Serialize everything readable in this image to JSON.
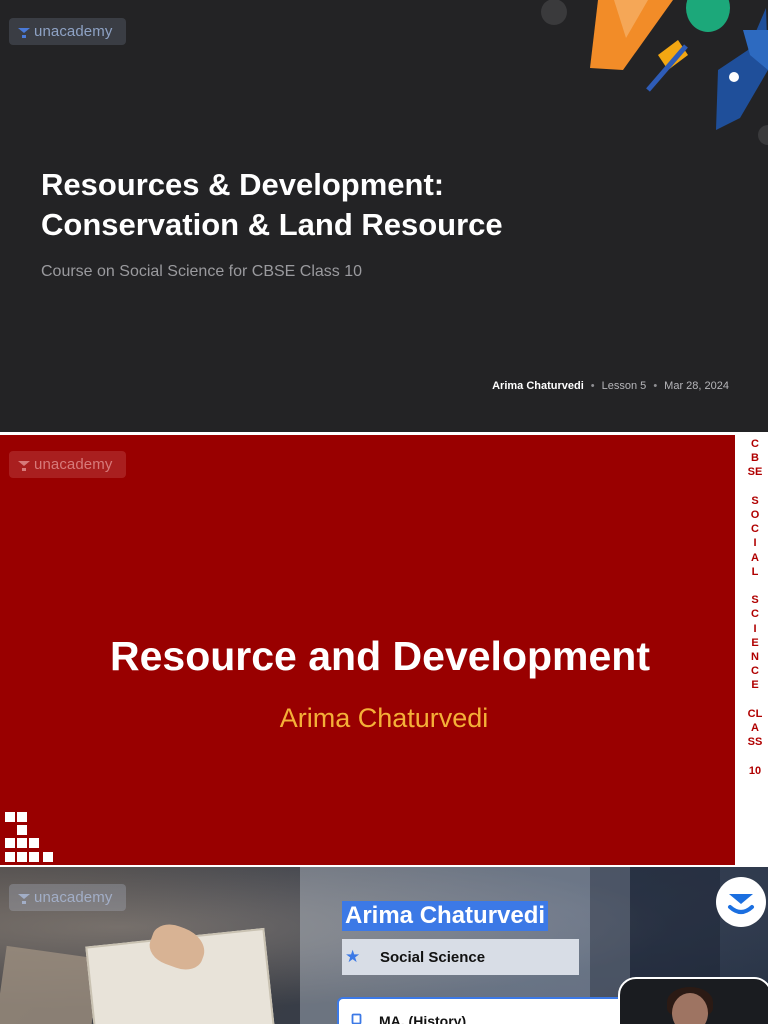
{
  "slide1": {
    "logo": "unacademy",
    "title_line1": "Resources & Development:",
    "title_line2": "Conservation & Land Resource",
    "subtitle": "Course on Social Science for CBSE Class 10",
    "author": "Arima Chaturvedi",
    "lesson": "Lesson 5",
    "date": "Mar 28, 2024",
    "bg_color": "#232325"
  },
  "slide2": {
    "logo": "unacademy",
    "title": "Resource and Development",
    "subtitle": "Arima Chaturvedi",
    "side_text": "C\nB\nSE\n\nS\nO\nC\nI\nA\nL\n\nS\nC\nI\nE\nN\nC\nE\n\nCL\nA\nSS\n\n10",
    "bg_color": "#990000",
    "accent_color": "#f4b038"
  },
  "slide3": {
    "logo": "unacademy",
    "educator_name": "Arima Chaturvedi",
    "subject": "Social Science",
    "degree": "MA. (History)",
    "accent_color": "#3c79e6"
  },
  "icons": {
    "logo_icon": "unacademy-logo-icon",
    "star_icon": "star-icon",
    "degree_icon": "degree-icon",
    "badge_icon": "unacademy-badge-icon"
  }
}
